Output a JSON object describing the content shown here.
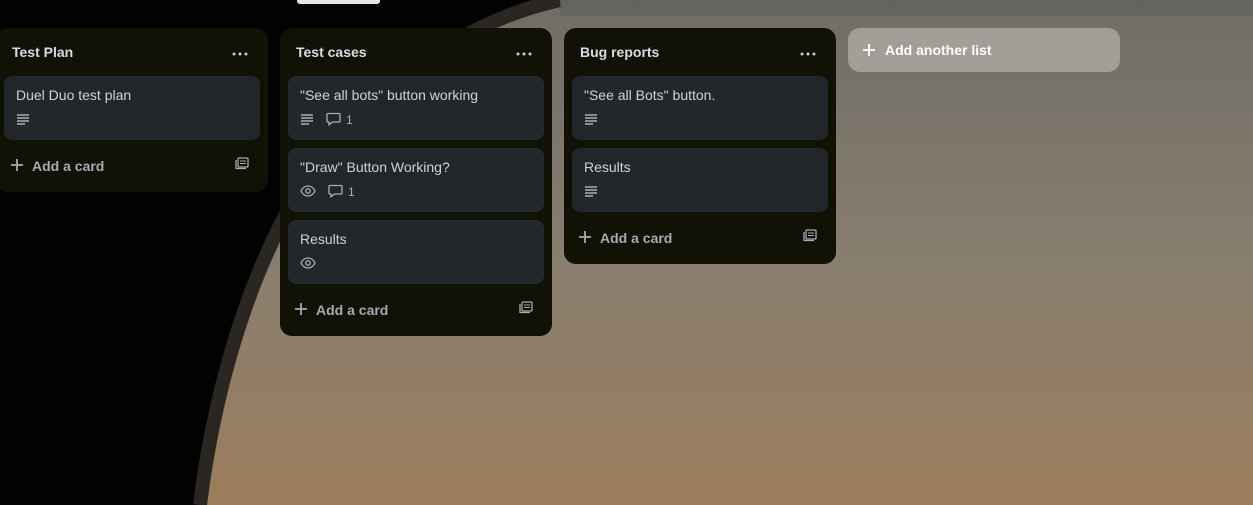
{
  "lists": [
    {
      "title": "Test Plan",
      "cards": [
        {
          "title": "Duel Duo test plan",
          "badges": [
            {
              "icon": "description-icon"
            }
          ]
        }
      ],
      "add_card": "Add a card"
    },
    {
      "title": "Test cases",
      "cards": [
        {
          "title": "\"See all bots\" button working",
          "badges": [
            {
              "icon": "description-icon"
            },
            {
              "icon": "comment-icon",
              "count": "1"
            }
          ]
        },
        {
          "title": "\"Draw\" Button Working?",
          "badges": [
            {
              "icon": "watch-icon"
            },
            {
              "icon": "comment-icon",
              "count": "1"
            }
          ]
        },
        {
          "title": "Results",
          "badges": [
            {
              "icon": "watch-icon"
            }
          ]
        }
      ],
      "add_card": "Add a card"
    },
    {
      "title": "Bug reports",
      "cards": [
        {
          "title": "\"See all Bots\" button.",
          "badges": [
            {
              "icon": "description-icon"
            }
          ]
        },
        {
          "title": "Results",
          "badges": [
            {
              "icon": "description-icon"
            }
          ]
        }
      ],
      "add_card": "Add a card"
    }
  ],
  "add_list": "Add another list",
  "colors": {
    "list_bg": "#111105",
    "card_bg": "#22272b",
    "add_list_bg": "#bebcb6"
  }
}
